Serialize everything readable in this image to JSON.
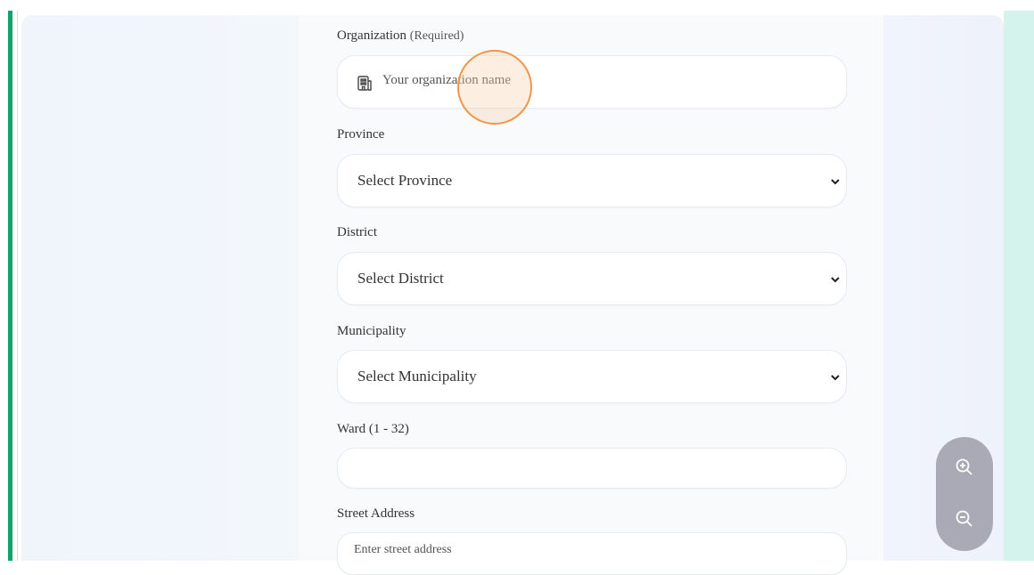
{
  "form": {
    "organization": {
      "label": "Organization",
      "required_note": "(Required)",
      "placeholder": "Your organization name"
    },
    "province": {
      "label": "Province",
      "value": "Select Province"
    },
    "district": {
      "label": "District",
      "value": "Select District"
    },
    "municipality": {
      "label": "Municipality",
      "value": "Select Municipality"
    },
    "ward": {
      "label": "Ward (1 - 32)",
      "value": ""
    },
    "street": {
      "label": "Street Address",
      "placeholder": "Enter street address"
    }
  },
  "icons": {
    "organization_field": "building-icon",
    "select_arrow": "chevron-down-icon",
    "zoom_in": "zoom-in-icon",
    "zoom_out": "zoom-out-icon"
  },
  "colors": {
    "accent_bar": "#11a36e",
    "cursor_ring": "#f0964a",
    "zoom_control_bg": "#a9aab6",
    "right_strip": "#d3f3ec"
  }
}
